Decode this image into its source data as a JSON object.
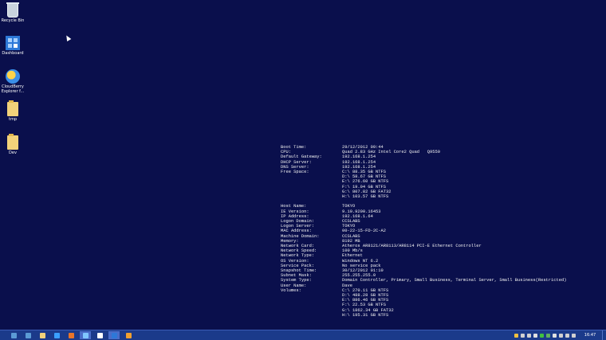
{
  "desktop": {
    "icons": [
      {
        "label": "Recycle Bin"
      },
      {
        "label": "Dashboard"
      },
      {
        "label": "CloudBerry\nExplorer f..."
      },
      {
        "label": "tmp"
      },
      {
        "label": "Dev"
      }
    ]
  },
  "bginfo": {
    "rows": [
      {
        "k": "Boot Time:",
        "v": "29/12/2012 09:44"
      },
      {
        "k": "CPU:",
        "v": "Quad 2.83 GHz Intel Core2 Quad   Q9550"
      },
      {
        "k": "Default Gateway:",
        "v": "192.168.1.254"
      },
      {
        "k": "DHCP Server:",
        "v": "192.168.1.254"
      },
      {
        "k": "DNS Server:",
        "v": "192.168.1.254"
      },
      {
        "k": "Free Space:",
        "v": "C:\\ 88.35 GB NTFS"
      },
      {
        "k": "",
        "v": "D:\\ 58.67 GB NTFS"
      },
      {
        "k": "",
        "v": "E:\\ 276.60 GB NTFS"
      },
      {
        "k": "",
        "v": "F:\\ 19.04 GB NTFS"
      },
      {
        "k": "",
        "v": "G:\\ 807.82 GB FAT32"
      },
      {
        "k": "",
        "v": "H:\\ 103.57 GB NTFS"
      },
      {
        "k": "",
        "v": ""
      },
      {
        "k": "Host Name:",
        "v": "TOKYO"
      },
      {
        "k": "IE Version:",
        "v": "9.10.9200.16453"
      },
      {
        "k": "IP Address:",
        "v": "192.168.1.64"
      },
      {
        "k": "Logon Domain:",
        "v": "CCSLABS"
      },
      {
        "k": "Logon Server:",
        "v": "TOKYO"
      },
      {
        "k": "MAC Address:",
        "v": "00-22-15-FD-2C-A2"
      },
      {
        "k": "Machine Domain:",
        "v": "CCSLABS"
      },
      {
        "k": "Memory:",
        "v": "8192 MB"
      },
      {
        "k": "Network Card:",
        "v": "Atheros AR8121/AR8113/AR8114 PCI-E Ethernet Controller"
      },
      {
        "k": "Network Speed:",
        "v": "100 Mb/s"
      },
      {
        "k": "Network Type:",
        "v": "Ethernet"
      },
      {
        "k": "OS Version:",
        "v": "Windows NT 6.2"
      },
      {
        "k": "Service Pack:",
        "v": "No service pack"
      },
      {
        "k": "Snapshot Time:",
        "v": "30/12/2012 01:10"
      },
      {
        "k": "Subnet Mask:",
        "v": "255.255.255.0"
      },
      {
        "k": "System Type:",
        "v": "Domain Controller, Primary, Small Business, Terminal Server, Small Business(Restricted)"
      },
      {
        "k": "User Name:",
        "v": "Dave"
      },
      {
        "k": "Volumes:",
        "v": "C:\\ 270.11 GB NTFS"
      },
      {
        "k": "",
        "v": "D:\\ 488.28 GB NTFS"
      },
      {
        "k": "",
        "v": "E:\\ 886.46 GB NTFS"
      },
      {
        "k": "",
        "v": "F:\\ 22.53 GB NTFS"
      },
      {
        "k": "",
        "v": "G:\\ 1862.34 GB FAT32"
      },
      {
        "k": "",
        "v": "H:\\ 195.31 GB NTFS"
      }
    ]
  },
  "taskbar": {
    "clock": "16:47",
    "apps": [
      {
        "icon": "server-manager-icon",
        "color": "#5b9bd5",
        "active": false
      },
      {
        "icon": "file-explorer-icon",
        "color": "#f2d27a",
        "active": false
      },
      {
        "icon": "internet-explorer-icon",
        "color": "#3aa0ff",
        "active": false
      },
      {
        "icon": "firefox-icon",
        "color": "#e8752a",
        "active": false
      },
      {
        "icon": "cloudberry-icon",
        "color": "#7fc6ff",
        "active": true
      },
      {
        "icon": "app-icon",
        "color": "#ffffff",
        "active": false
      },
      {
        "icon": "dashboard-icon",
        "color": "#2d78d8",
        "active": true
      },
      {
        "icon": "installer-icon",
        "color": "#f0a030",
        "active": false
      }
    ],
    "tray": [
      {
        "icon": "sync-icon",
        "color": "#f0c040"
      },
      {
        "icon": "volume-icon",
        "color": "#d0d0d0"
      },
      {
        "icon": "network-icon",
        "color": "#d0d0d0"
      },
      {
        "icon": "shield-icon",
        "color": "#e0e0e0"
      },
      {
        "icon": "check-icon",
        "color": "#40c040"
      },
      {
        "icon": "update-icon",
        "color": "#60b060"
      },
      {
        "icon": "flag-icon",
        "color": "#e0e0e0"
      },
      {
        "icon": "monitor-icon",
        "color": "#d0d0d0"
      },
      {
        "icon": "keyboard-icon",
        "color": "#d0d0d0"
      },
      {
        "icon": "chat-icon",
        "color": "#d0d0d0"
      }
    ]
  }
}
